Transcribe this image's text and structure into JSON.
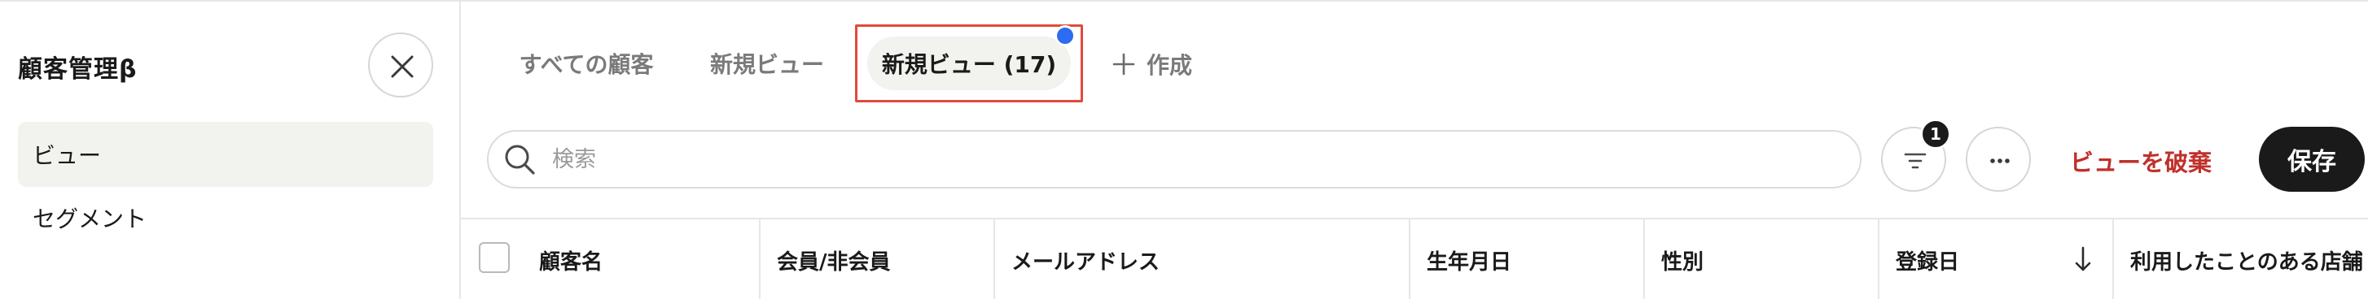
{
  "sidebar": {
    "title": "顧客管理β",
    "items": [
      {
        "label": "ビュー"
      },
      {
        "label": "セグメント"
      }
    ]
  },
  "tabs": [
    {
      "label": "すべての顧客"
    },
    {
      "label": "新規ビュー"
    },
    {
      "label": "新規ビュー (17)"
    }
  ],
  "create_label": "作成",
  "search": {
    "placeholder": "検索"
  },
  "filter_badge": "1",
  "discard_label": "ビューを破棄",
  "save_label": "保存",
  "table": {
    "columns": [
      {
        "label": "顧客名"
      },
      {
        "label": "会員/非会員"
      },
      {
        "label": "メールアドレス"
      },
      {
        "label": "生年月日"
      },
      {
        "label": "性別"
      },
      {
        "label": "登録日"
      },
      {
        "label": "利用したことのある店舗"
      }
    ]
  },
  "colors": {
    "accent_dot": "#2d6bf0",
    "highlight_border": "#e14a3a",
    "discard_text": "#c0302a",
    "save_bg": "#1a1a1a"
  },
  "icons": [
    "close-icon",
    "plus-icon",
    "search-icon",
    "filter-icon",
    "more-icon",
    "sort-down-icon"
  ]
}
